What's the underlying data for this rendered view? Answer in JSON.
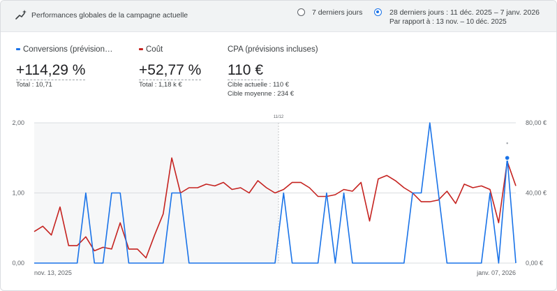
{
  "header": {
    "title": "Performances globales de la campagne actuelle",
    "icon": "sparkle-trend-icon",
    "range_7": "7 derniers jours",
    "range_28": "28 derniers jours : 11 déc. 2025 – 7 janv. 2026",
    "range_28_compare": "Par rapport à : 13 nov. – 10 déc. 2025",
    "selected_range": "28 derniers jours"
  },
  "metrics": {
    "conversions": {
      "label": "Conversions (prévision…",
      "value": "+114,29 %",
      "sub": "Total : 10,71",
      "color": "#1a73e8"
    },
    "cost": {
      "label": "Coût",
      "value": "+52,77 %",
      "sub": "Total : 1,18 k €",
      "color": "#c5221f"
    },
    "cpa": {
      "label": "CPA (prévisions incluses)",
      "value": "110 €",
      "sub1": "Cible actuelle : 110 €",
      "sub2": "Cible moyenne : 234 €"
    }
  },
  "chart_data": {
    "type": "line",
    "marker_label": "11/12",
    "x_labels": [
      "nov. 13, 2025",
      "janv. 07, 2026"
    ],
    "left_axis": {
      "ticks": [
        "0,00",
        "1,00",
        "2,00"
      ],
      "ylim": [
        0,
        2
      ]
    },
    "right_axis": {
      "ticks": [
        "0,00 €",
        "40,00 €",
        "80,00 €"
      ],
      "ylim": [
        0,
        80
      ]
    },
    "grid": true,
    "series": [
      {
        "name": "Conversions (prévision…",
        "axis": "left",
        "color": "#1a73e8",
        "values": [
          0,
          0,
          0,
          0,
          0,
          0,
          1,
          0,
          0,
          1,
          1,
          0,
          0,
          0,
          0,
          0,
          1,
          1,
          0,
          0,
          0,
          0,
          0,
          0,
          0,
          0,
          0,
          0,
          0,
          1,
          0,
          0,
          0,
          0,
          1,
          0,
          1,
          0,
          0,
          0,
          0,
          0,
          0,
          0,
          1,
          1,
          2,
          1,
          0,
          0,
          0,
          0,
          0,
          1,
          0,
          1.5,
          0
        ]
      },
      {
        "name": "Coût",
        "axis": "right",
        "color": "#c5221f",
        "values": [
          18,
          21,
          16,
          32,
          10,
          10,
          15,
          7,
          9,
          8,
          23,
          8,
          8,
          3,
          16,
          28,
          60,
          40,
          43,
          43,
          45,
          44,
          46,
          42,
          43,
          40,
          47,
          43,
          40,
          42,
          46,
          46,
          43,
          38,
          38,
          39,
          42,
          41,
          46,
          24,
          48,
          50,
          47,
          43,
          40,
          35,
          35,
          36,
          41,
          34,
          45,
          43,
          44,
          42,
          23,
          58,
          44
        ]
      }
    ],
    "highlight_point": {
      "series": "Conversions (prévision…",
      "index": 55,
      "value": 1.5
    }
  }
}
